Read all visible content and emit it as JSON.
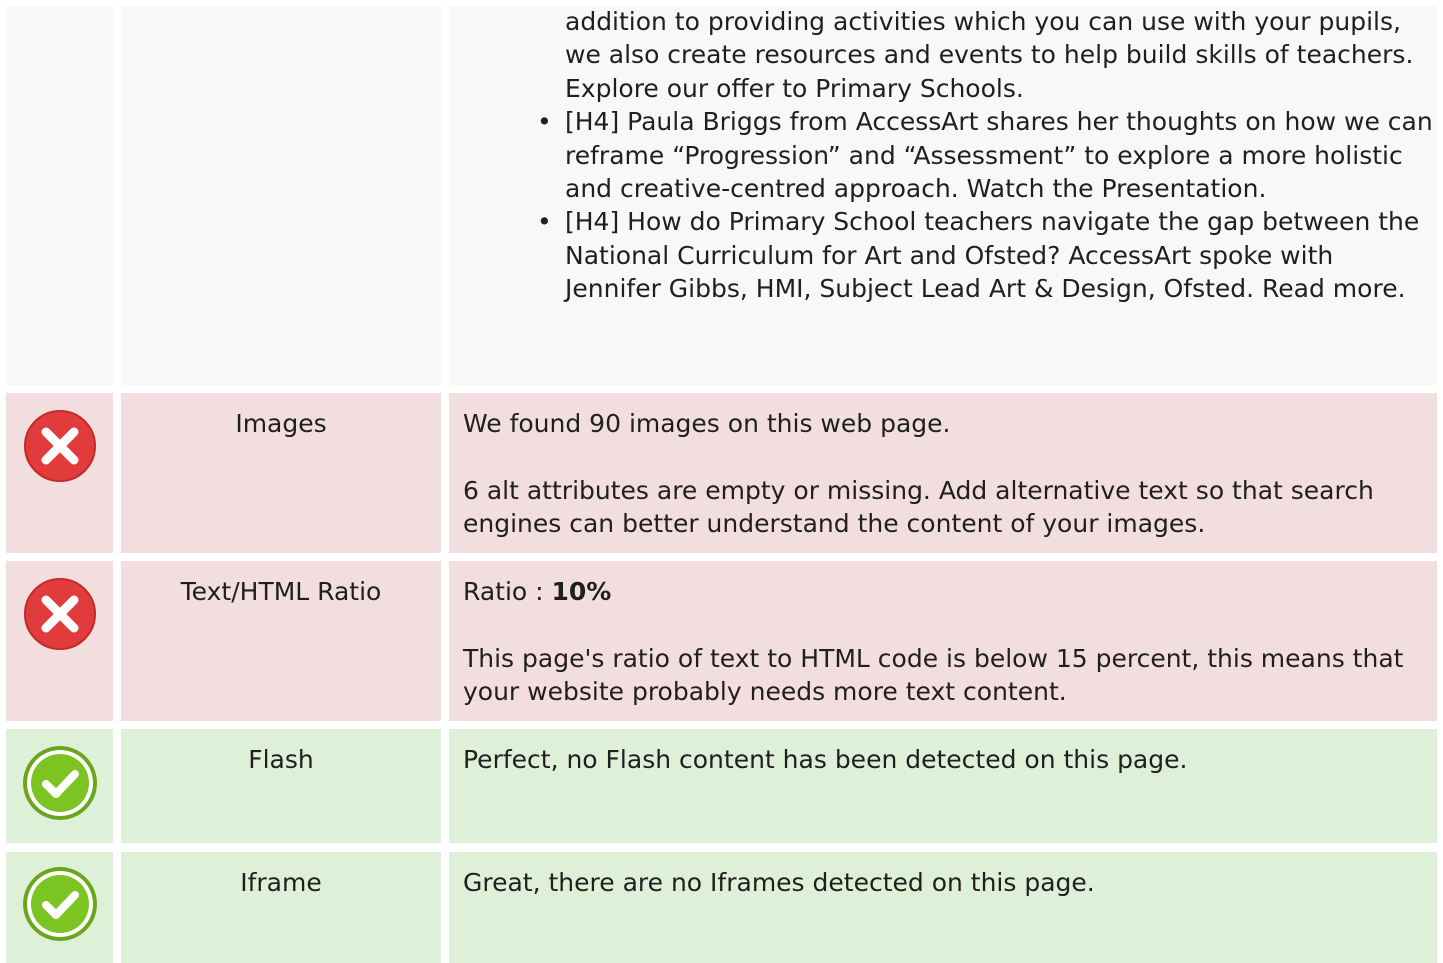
{
  "rows": [
    {
      "status": "neutral",
      "label": "",
      "items": [
        "addition to providing activities which you can use with your pupils, we also create resources and events to help build skills of teachers. Explore our offer to Primary Schools.",
        "[H4] Paula Briggs from AccessArt shares her thoughts on how we can reframe “Progression” and “Assessment” to explore a more holistic and creative-centred approach. Watch the Presentation.",
        "[H4] How do Primary School teachers navigate the gap between the National Curriculum for Art and Ofsted? AccessArt spoke with Jennifer Gibbs, HMI, Subject Lead Art & Design, Ofsted. Read more."
      ]
    },
    {
      "status": "error",
      "icon": "error-x-icon",
      "label": "Images",
      "lines": [
        "We found 90 images on this web page.",
        "6 alt attributes are empty or missing. Add alternative text so that search engines can better understand the content of your images."
      ]
    },
    {
      "status": "error",
      "icon": "error-x-icon",
      "label": "Text/HTML Ratio",
      "ratio_prefix": "Ratio : ",
      "ratio_value": "10%",
      "lines": [
        "This page's ratio of text to HTML code is below 15 percent, this means that your website probably needs more text content."
      ]
    },
    {
      "status": "ok",
      "icon": "check-icon",
      "label": "Flash",
      "lines": [
        "Perfect, no Flash content has been detected on this page."
      ]
    },
    {
      "status": "ok",
      "icon": "check-icon",
      "label": "Iframe",
      "lines": [
        "Great, there are no Iframes detected on this page."
      ]
    }
  ],
  "colors": {
    "error_bg": "#f2dede",
    "ok_bg": "#dff0d8",
    "neutral_bg": "#f8f8f8",
    "error_icon": "#e23b3b",
    "ok_icon": "#7cc421"
  }
}
